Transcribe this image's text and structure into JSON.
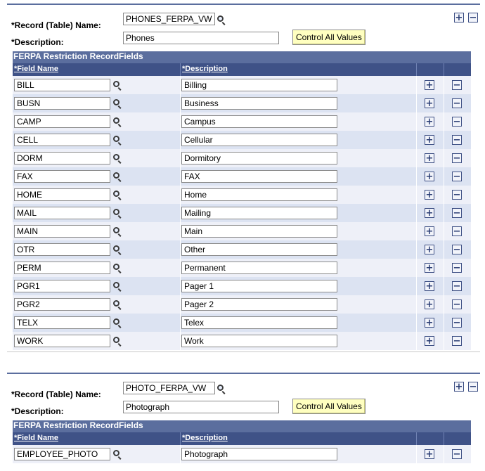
{
  "section1": {
    "record_label": "*Record (Table) Name:",
    "record_value": "PHONES_FERPA_VW",
    "desc_label": "*Description:",
    "desc_value": "Phones",
    "control_button": "Control All Values",
    "grid_title": "FERPA Restriction RecordFields",
    "col_field": "*Field Name",
    "col_desc": "*Description",
    "rows": [
      {
        "field": "BILL",
        "desc": "Billing"
      },
      {
        "field": "BUSN",
        "desc": "Business"
      },
      {
        "field": "CAMP",
        "desc": "Campus"
      },
      {
        "field": "CELL",
        "desc": "Cellular"
      },
      {
        "field": "DORM",
        "desc": "Dormitory"
      },
      {
        "field": "FAX",
        "desc": "FAX"
      },
      {
        "field": "HOME",
        "desc": "Home"
      },
      {
        "field": "MAIL",
        "desc": "Mailing"
      },
      {
        "field": "MAIN",
        "desc": "Main"
      },
      {
        "field": "OTR",
        "desc": "Other"
      },
      {
        "field": "PERM",
        "desc": "Permanent"
      },
      {
        "field": "PGR1",
        "desc": "Pager 1"
      },
      {
        "field": "PGR2",
        "desc": "Pager 2"
      },
      {
        "field": "TELX",
        "desc": "Telex"
      },
      {
        "field": "WORK",
        "desc": "Work"
      }
    ]
  },
  "section2": {
    "record_label": "*Record (Table) Name:",
    "record_value": "PHOTO_FERPA_VW",
    "desc_label": "*Description:",
    "desc_value": "Photograph",
    "control_button": "Control All Values",
    "grid_title": "FERPA Restriction RecordFields",
    "col_field": "*Field Name",
    "col_desc": "*Description",
    "rows": [
      {
        "field": "EMPLOYEE_PHOTO",
        "desc": "Photograph"
      }
    ]
  },
  "icons": {
    "plus": "+",
    "minus": "−",
    "lookup": "magnifier-icon"
  },
  "colors": {
    "header": "#5b6e9e",
    "row_odd": "#eef0f8",
    "row_even": "#dce3f2",
    "button_bg": "#ffffc0"
  }
}
